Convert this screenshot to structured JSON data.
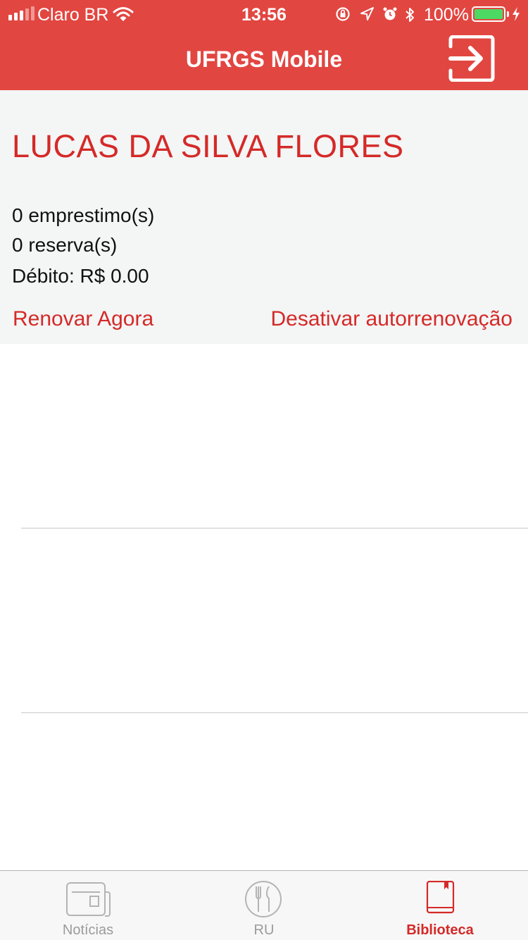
{
  "status_bar": {
    "carrier": "Claro BR",
    "time": "13:56",
    "battery_percent": "100%",
    "signal_bars_full": 3,
    "signal_bars_total": 5,
    "icons": [
      "wifi-icon",
      "orientation-lock-icon",
      "location-icon",
      "alarm-icon",
      "bluetooth-icon",
      "battery-icon",
      "charging-icon"
    ]
  },
  "nav": {
    "title": "UFRGS Mobile",
    "logout_icon": "logout-icon"
  },
  "profile": {
    "name": "LUCAS DA SILVA FLORES",
    "loans": "0 emprestimo(s)",
    "reserves": "0 reserva(s)",
    "debt": "Débito: R$ 0.00",
    "renew_now": "Renovar Agora",
    "disable_autorenew": "Desativar autorrenovação"
  },
  "tabs": [
    {
      "label": "Notícias",
      "icon": "newspaper-icon",
      "active": false
    },
    {
      "label": "RU",
      "icon": "plate-cutlery-icon",
      "active": false
    },
    {
      "label": "Biblioteca",
      "icon": "book-icon",
      "active": true
    }
  ],
  "colors": {
    "brand_red": "#e24641",
    "accent_red": "#d42a28",
    "tab_inactive": "#9b9b9b",
    "panel_bg": "#f4f5f5"
  }
}
